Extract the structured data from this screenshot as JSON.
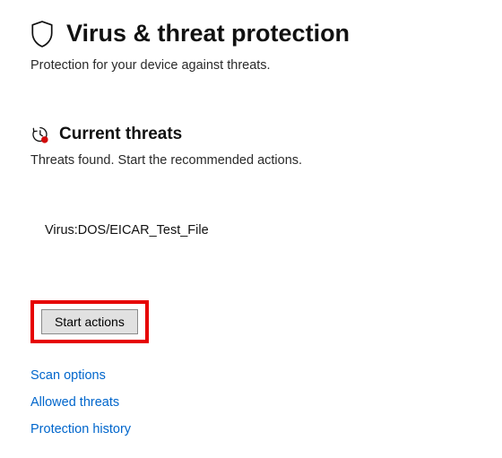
{
  "header": {
    "title": "Virus & threat protection",
    "subtitle": "Protection for your device against threats."
  },
  "section": {
    "title": "Current threats",
    "subtitle": "Threats found. Start the recommended actions."
  },
  "threats": [
    {
      "name": "Virus:DOS/EICAR_Test_File"
    }
  ],
  "actions": {
    "start_label": "Start actions"
  },
  "links": {
    "scan_options": "Scan options",
    "allowed_threats": "Allowed threats",
    "protection_history": "Protection history"
  }
}
